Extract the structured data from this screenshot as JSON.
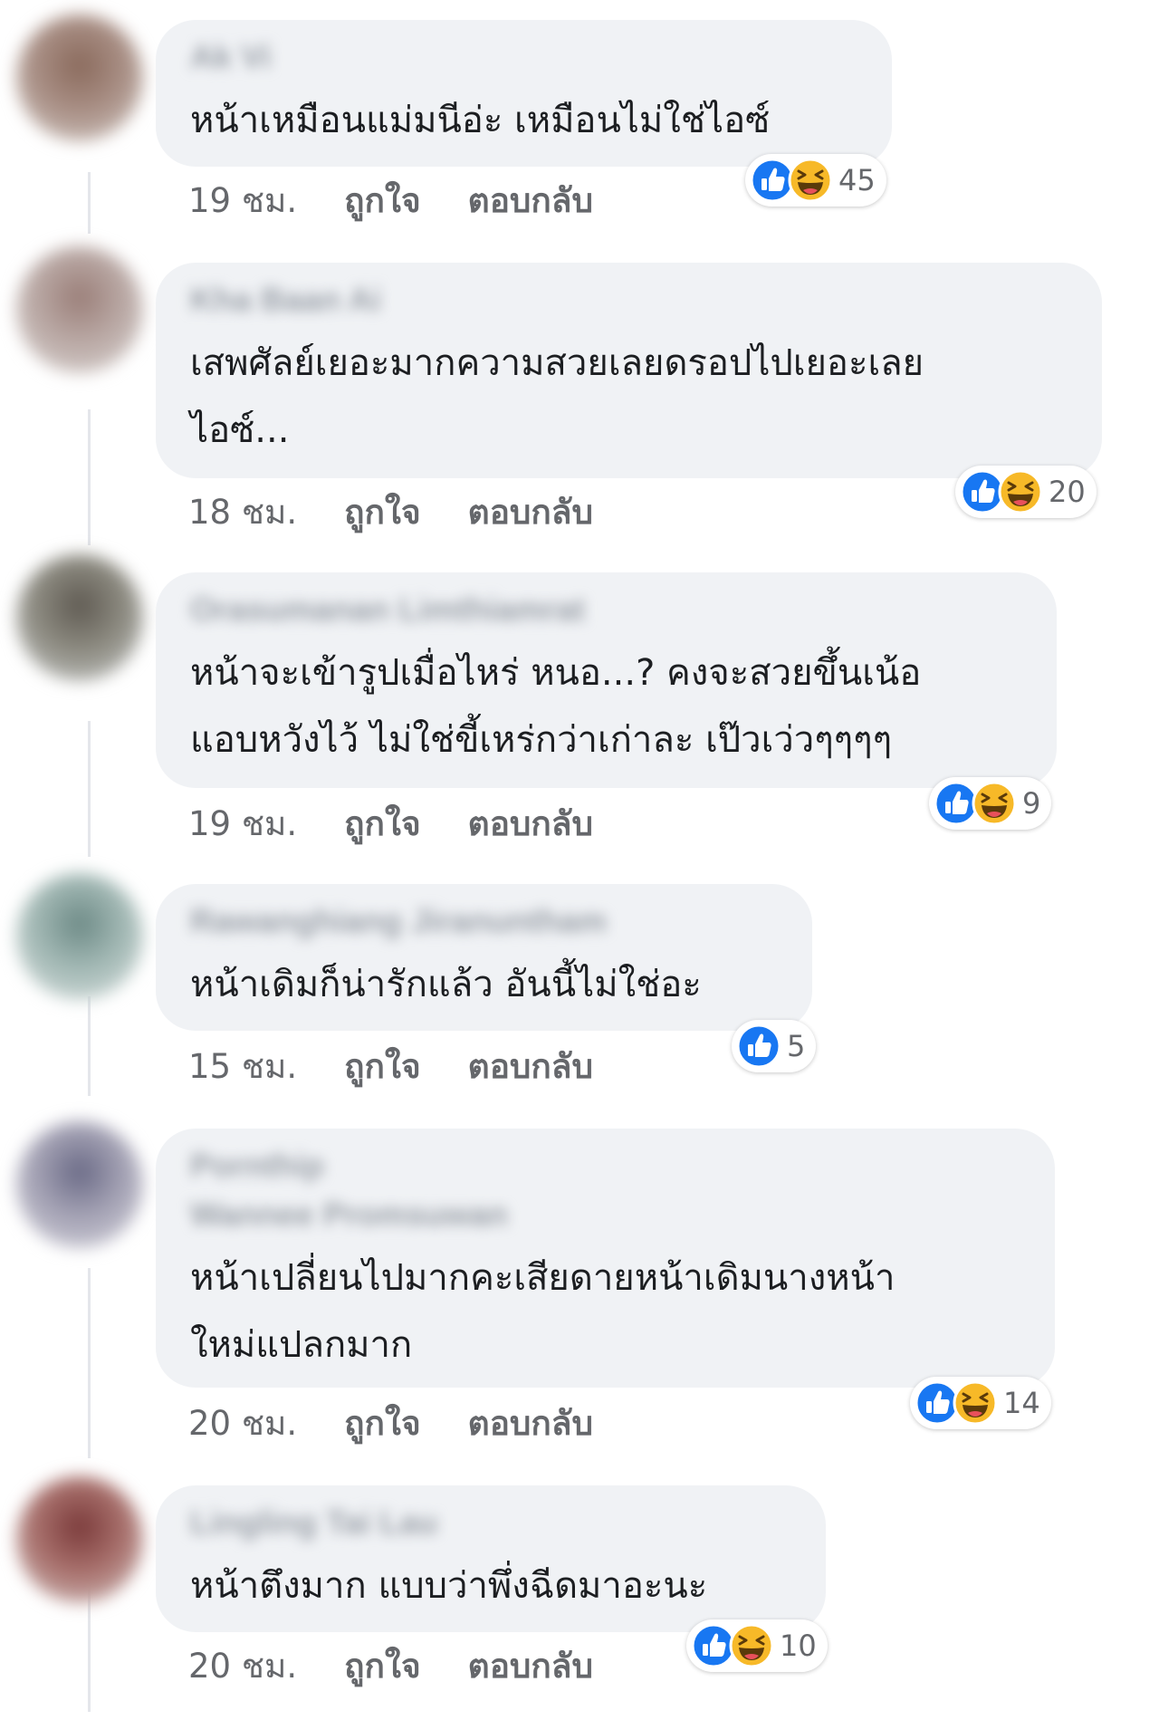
{
  "comments": [
    {
      "author": "Ak Vi",
      "author_sub": "",
      "text_lines": [
        "หน้าเหมือนแม่มนีอ่ะ เหมือนไม่ใช่ไอซ์"
      ],
      "time": "19 ชม.",
      "like_label": "ถูกใจ",
      "reply_label": "ตอบกลับ",
      "reactions": [
        "like-icon",
        "haha-icon"
      ],
      "reaction_count": "45"
    },
    {
      "author": "Kha Baan Ai",
      "author_sub": "",
      "text_lines": [
        "เสพศัลย์เยอะมากความสวยเลยดรอปไปเยอะเลย",
        "ไอซ์..."
      ],
      "time": "18 ชม.",
      "like_label": "ถูกใจ",
      "reply_label": "ตอบกลับ",
      "reactions": [
        "like-icon",
        "haha-icon"
      ],
      "reaction_count": "20"
    },
    {
      "author": "Orasumanan Limthiamrat",
      "author_sub": "",
      "text_lines": [
        "หน้าจะเข้ารูปเมื่อไหร่ หนอ...? คงจะสวยขึ้นเน้อ",
        "แอบหวังไว้ ไม่ใช่ขี้เหร่กว่าเก่าละ เป๊วเว่วๆๆๆๆ"
      ],
      "time": "19 ชม.",
      "like_label": "ถูกใจ",
      "reply_label": "ตอบกลับ",
      "reactions": [
        "like-icon",
        "haha-icon"
      ],
      "reaction_count": "9"
    },
    {
      "author": "Rawanghiang Jiranuntham",
      "author_sub": "",
      "text_lines": [
        "หน้าเดิมก็น่ารักแล้ว อันนี้ไม่ใช่อะ"
      ],
      "time": "15 ชม.",
      "like_label": "ถูกใจ",
      "reply_label": "ตอบกลับ",
      "reactions": [
        "like-icon"
      ],
      "reaction_count": "5"
    },
    {
      "author": "Pornthip",
      "author_sub": "Wannee Promsuwan",
      "text_lines": [
        "หน้าเปลี่ยนไปมากคะเสียดายหน้าเดิมนางหน้า",
        "ใหม่แปลกมาก"
      ],
      "time": "20 ชม.",
      "like_label": "ถูกใจ",
      "reply_label": "ตอบกลับ",
      "reactions": [
        "like-icon",
        "haha-icon"
      ],
      "reaction_count": "14"
    },
    {
      "author": "Lingling Tai Lau",
      "author_sub": "",
      "text_lines": [
        "หน้าตึงมาก แบบว่าพึ่งฉีดมาอะนะ"
      ],
      "time": "20 ชม.",
      "like_label": "ถูกใจ",
      "reply_label": "ตอบกลับ",
      "reactions": [
        "like-icon",
        "haha-icon"
      ],
      "reaction_count": "10"
    }
  ],
  "colors": {
    "bubble": "#f0f2f5",
    "text": "#1c1e21",
    "meta": "#65676b",
    "like_blue": "#1877f2",
    "haha_yellow": "#f7b928"
  }
}
